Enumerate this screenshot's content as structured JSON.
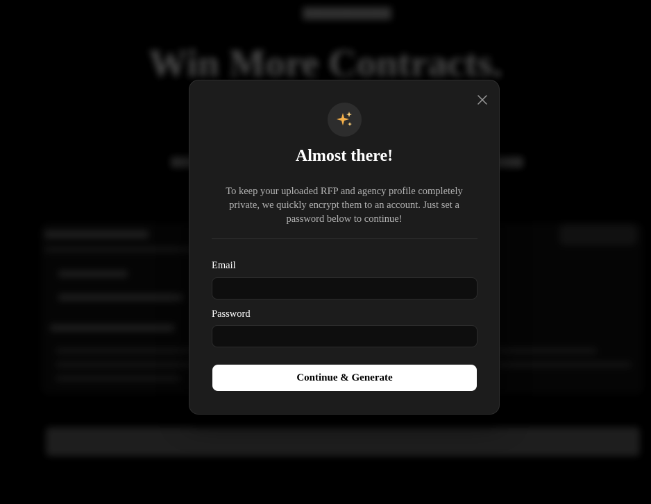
{
  "background": {
    "logo": "████████████",
    "hero_title": "Win More Contracts.",
    "subtitle": "▇▇▇▇▇▇ ▇▇▇▇▇▇▇▇ ▇▇▇▇▇▇ ▇▇▇▇▇▇▇ ▇▇▇▇ ▇▇▇▇▇ ▇▇▇▇▇▇"
  },
  "modal": {
    "icon": "sparkles-icon",
    "title": "Almost there!",
    "description": "To keep your uploaded RFP and agency profile completely private, we quickly encrypt them to an account. Just set a password below to continue!",
    "email_label": "Email",
    "email_value": "",
    "password_label": "Password",
    "password_value": "",
    "submit_label": "Continue & Generate",
    "close_icon": "close-icon"
  },
  "colors": {
    "modal_bg": "#1c1c1c",
    "button_bg": "#ffffff",
    "sparkle_accent": "#f5b049"
  }
}
